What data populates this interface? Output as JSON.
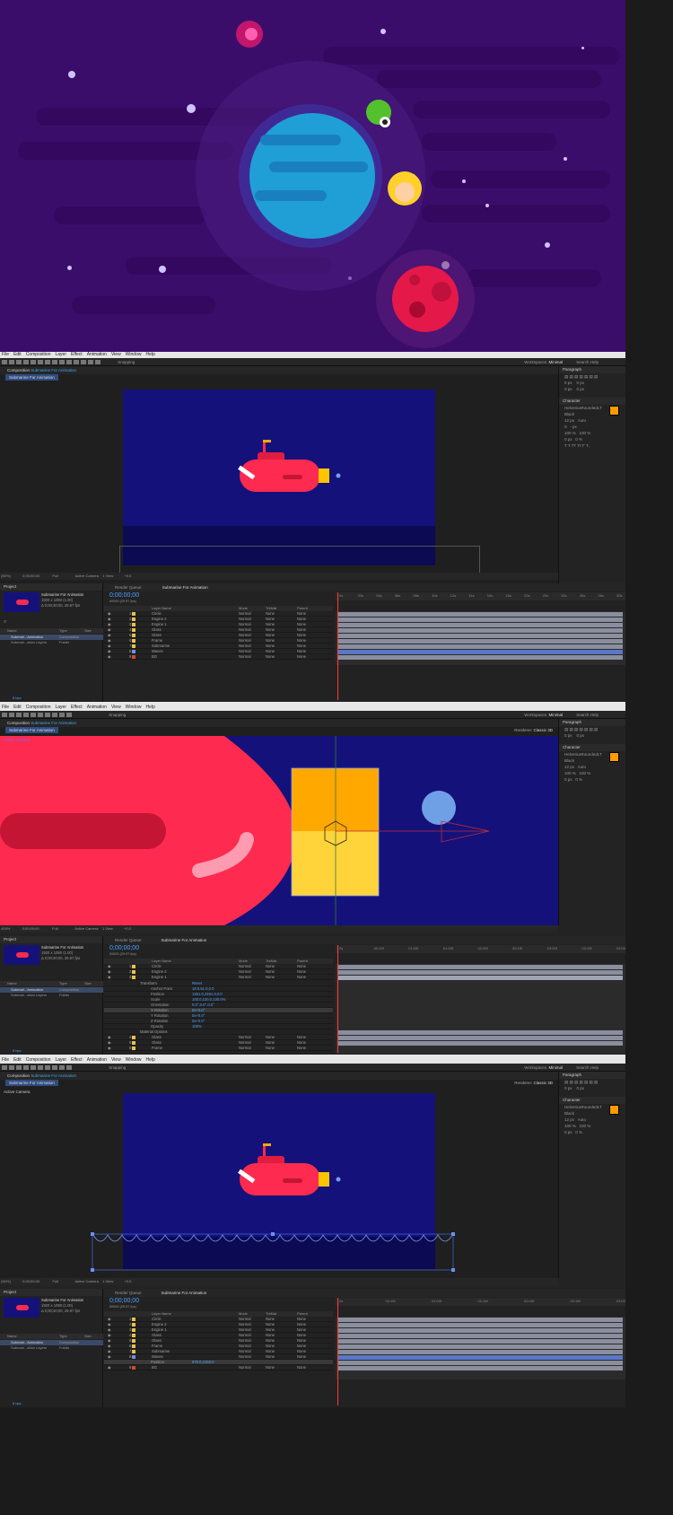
{
  "colors": {
    "hero_bg": "#3b0d6b",
    "stage_bg": "#14127a",
    "submarine": "#ff2a4f",
    "engine_top": "#ffa800",
    "engine_bottom": "#ffd43a",
    "bubble": "#6fa0e6",
    "timecode": "#4ea4ff",
    "layer_bar": "#8a8e9e",
    "waves_bar": "#5a78c8"
  },
  "menu": [
    "File",
    "Edit",
    "Composition",
    "Layer",
    "Effect",
    "Animation",
    "View",
    "Window",
    "Help"
  ],
  "toolbar": {
    "snapping": "Snapping",
    "workspaces": "Workspaces",
    "workspace_value": "Minimal",
    "search": "Search Help"
  },
  "comp_panel": {
    "label": "Composition",
    "name": "Submarine For Animation",
    "tab": "Submarine For Animation"
  },
  "renderer": {
    "label": "Renderer:",
    "value": "Classic 3D"
  },
  "active_camera_tag": "Active Camera",
  "viewer_bar": {
    "zoom1": "(50%)",
    "zoom2": "400%",
    "time": "0;00;00;00",
    "quality": "Full",
    "camera": "Active Camera",
    "views": "1 View",
    "exposure": "+0.0"
  },
  "right_panel": {
    "paragraph": "Paragraph",
    "character": "Character",
    "font": "HelveticaRoundedLT",
    "style": "Black",
    "size": "12 px",
    "leading": "Auto",
    "tracking": "0",
    "px_label": "- px",
    "scale_v": "100 %",
    "scale_h": "100 %",
    "baseline": "0 px",
    "tsume": "0 %",
    "indent_values": [
      "0 px",
      "0 px",
      "0 px",
      "0 px",
      "0 px"
    ]
  },
  "project": {
    "label": "Project",
    "comp_name": "Submarine For Animation",
    "comp_size": "1920 x 1080 (1.00)",
    "comp_duration": "Δ 0;00;30;00, 29.97 fps",
    "col_name": "Name",
    "col_type": "Type",
    "col_size": "Size",
    "items": [
      {
        "name": "Submari...Animation",
        "type": "Composition"
      },
      {
        "name": "Submari...ation Layers",
        "type": "Folder"
      }
    ],
    "bpc": "8 bpc"
  },
  "timeline": {
    "render_queue": "Render Queue",
    "tab": "Submarine For Animation",
    "timecode": "0;00;00;00",
    "frame": "00000 (29.97 fps)",
    "col_layer": "Layer Name",
    "col_mode": "Mode",
    "col_trkmat": "TrkMat",
    "col_parent": "Parent",
    "mode_value": "Normal",
    "none_value": "None",
    "ruler_a": [
      "0s",
      "02s",
      "04s",
      "06s",
      "08s",
      "10s",
      "12s",
      "14s",
      "16s",
      "18s",
      "20s",
      "22s",
      "24s",
      "26s",
      "28s",
      "30s"
    ],
    "ruler_b": [
      "0s",
      "00:15f",
      "01:00f",
      "01:15f",
      "02:00f",
      "02:15f",
      "03:00f",
      "03:15f",
      "04:00f"
    ],
    "ruler_c": [
      "0s",
      "00:15f",
      "01:00f",
      "01:15f",
      "02:00f",
      "02:15f",
      "03:00f"
    ]
  },
  "layers_a": [
    {
      "num": "1",
      "name": "Circle",
      "color": "#e6c34d"
    },
    {
      "num": "2",
      "name": "Engine 2",
      "color": "#e6c34d"
    },
    {
      "num": "3",
      "name": "Engine 1",
      "color": "#e6c34d"
    },
    {
      "num": "4",
      "name": "Glass",
      "color": "#e6c34d"
    },
    {
      "num": "5",
      "name": "Glass",
      "color": "#e6c34d"
    },
    {
      "num": "6",
      "name": "Frame",
      "color": "#e6c34d"
    },
    {
      "num": "7",
      "name": "Submarine",
      "color": "#e6c34d"
    },
    {
      "num": "8",
      "name": "Waves",
      "color": "#6a93e0"
    },
    {
      "num": "9",
      "name": "BG",
      "color": "#d9462f"
    }
  ],
  "layers_b": [
    {
      "num": "1",
      "name": "Circle",
      "color": "#e6c34d"
    },
    {
      "num": "2",
      "name": "Engine 2",
      "color": "#e6c34d"
    },
    {
      "num": "3",
      "name": "Engine 1",
      "color": "#e6c34d"
    }
  ],
  "transform": {
    "label": "Transform",
    "reset": "Reset",
    "props": [
      {
        "name": "Anchor Point",
        "value": "18.0,51.0,0.0"
      },
      {
        "name": "Position",
        "value": "1251.0,2461.0,0.0"
      },
      {
        "name": "Scale",
        "value": "100.0,100.0,100.0%"
      },
      {
        "name": "Orientation",
        "value": "0.0°,0.0°,0.0°"
      },
      {
        "name": "X Rotation",
        "value": "0x+0.0°"
      },
      {
        "name": "Y Rotation",
        "value": "0x+0.0°"
      },
      {
        "name": "Z Rotation",
        "value": "0x+0.0°"
      },
      {
        "name": "Opacity",
        "value": "100%"
      }
    ],
    "material": "Material Options"
  },
  "layers_b2": [
    {
      "num": "4",
      "name": "Glass",
      "color": "#e6c34d"
    },
    {
      "num": "5",
      "name": "Glass",
      "color": "#e6c34d"
    },
    {
      "num": "6",
      "name": "Frame",
      "color": "#e6c34d"
    }
  ],
  "layers_c": [
    {
      "num": "1",
      "name": "Circle",
      "color": "#e6c34d"
    },
    {
      "num": "2",
      "name": "Engine 2",
      "color": "#e6c34d"
    },
    {
      "num": "3",
      "name": "Engine 1",
      "color": "#e6c34d"
    },
    {
      "num": "4",
      "name": "Glass",
      "color": "#e6c34d"
    },
    {
      "num": "5",
      "name": "Glass",
      "color": "#e6c34d"
    },
    {
      "num": "6",
      "name": "Frame",
      "color": "#e6c34d"
    },
    {
      "num": "7",
      "name": "Submarine",
      "color": "#e6c34d"
    },
    {
      "num": "8",
      "name": "Waves",
      "color": "#6a93e0"
    },
    {
      "num": "9",
      "name": "BG",
      "color": "#d9462f"
    }
  ],
  "waves_position": {
    "name": "Position",
    "value": "976.0,2166.0"
  }
}
